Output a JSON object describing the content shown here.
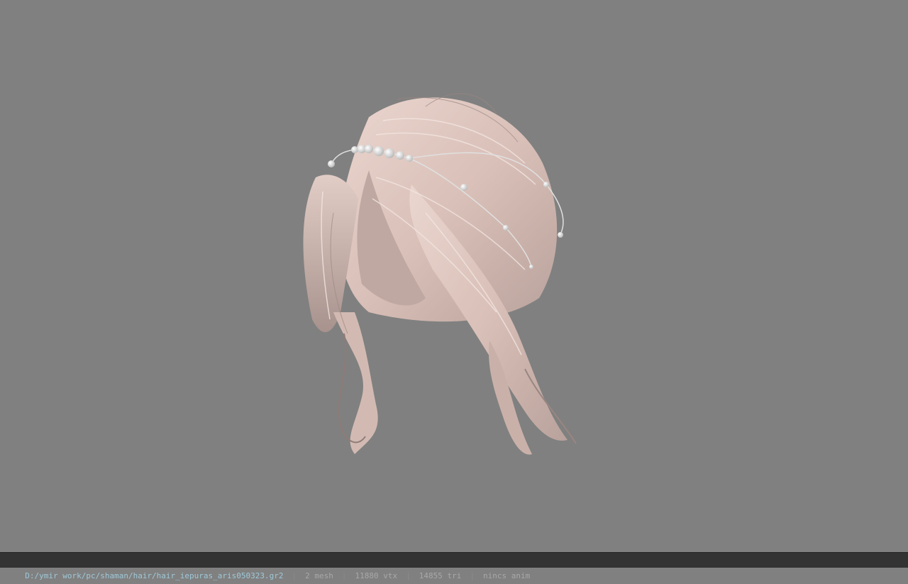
{
  "viewer": {
    "background": "#808080",
    "model_name": "hair_iepuras_aris050323"
  },
  "status_bar": {
    "file_path": "D:/ymir work/pc/shaman/hair/hair_iepuras_aris050323.gr2",
    "mesh_count": "2 mesh",
    "vertex_count": "11880 vtx",
    "triangle_count": "14855 tri",
    "anim_status": "nincs anim",
    "separator": "|",
    "path_color": "#9ec8d8",
    "text_color": "#a8a8a8"
  }
}
